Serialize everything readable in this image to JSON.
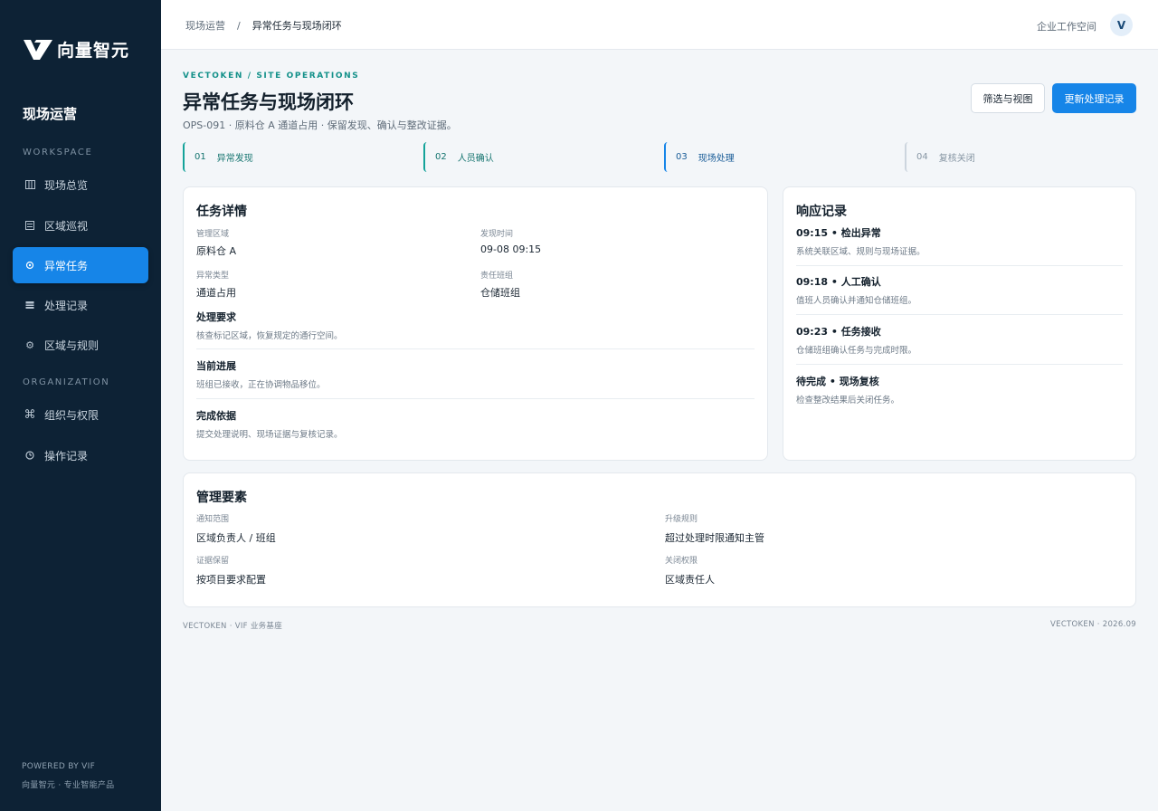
{
  "brand": {
    "name": "向量智元"
  },
  "sidebar": {
    "title": "现场运营",
    "workspace_label": "WORKSPACE",
    "organization_label": "ORGANIZATION",
    "workspace_items": [
      {
        "label": "现场总览",
        "icon": "columns-icon"
      },
      {
        "label": "区域巡视",
        "icon": "list-icon"
      },
      {
        "label": "异常任务",
        "icon": "target-icon",
        "active": true
      },
      {
        "label": "处理记录",
        "icon": "grid-icon"
      },
      {
        "label": "区域与规则",
        "icon": "gear-icon"
      }
    ],
    "organization_items": [
      {
        "label": "组织与权限",
        "icon": "command-icon"
      },
      {
        "label": "操作记录",
        "icon": "clock-icon"
      }
    ],
    "footer_line1": "POWERED BY VIF",
    "footer_line2": "向量智元 · 专业智能产品"
  },
  "topbar": {
    "breadcrumb_parent": "现场运营",
    "breadcrumb_sep": "/",
    "breadcrumb_current": "异常任务与现场闭环",
    "workspace": "企业工作空间",
    "avatar": "V"
  },
  "header": {
    "eyebrow": "VECTOKEN / SITE OPERATIONS",
    "title": "异常任务与现场闭环",
    "subtitle": "OPS-091 · 原料仓 A 通道占用 · 保留发现、确认与整改证据。",
    "filter_button": "筛选与视图",
    "primary_button": "更新处理记录"
  },
  "steps": [
    {
      "num": "01",
      "label": "异常发现",
      "state": "done"
    },
    {
      "num": "02",
      "label": "人员确认",
      "state": "done"
    },
    {
      "num": "03",
      "label": "现场处理",
      "state": "current"
    },
    {
      "num": "04",
      "label": "复核关闭",
      "state": "todo"
    }
  ],
  "task_detail": {
    "title": "任务详情",
    "fields": [
      {
        "label": "管理区域",
        "value": "原料仓 A"
      },
      {
        "label": "发现时间",
        "value": "09-08 09:15"
      },
      {
        "label": "异常类型",
        "value": "通道占用"
      },
      {
        "label": "责任班组",
        "value": "仓储班组"
      }
    ],
    "blocks": [
      {
        "title": "处理要求",
        "desc": "核查标记区域，恢复规定的通行空间。"
      },
      {
        "title": "当前进展",
        "desc": "班组已接收，正在协调物品移位。"
      },
      {
        "title": "完成依据",
        "desc": "提交处理说明、现场证据与复核记录。"
      }
    ]
  },
  "response_log": {
    "title": "响应记录",
    "entries": [
      {
        "title": "09:15 • 检出异常",
        "desc": "系统关联区域、规则与现场证据。"
      },
      {
        "title": "09:18 • 人工确认",
        "desc": "值班人员确认并通知仓储班组。"
      },
      {
        "title": "09:23 • 任务接收",
        "desc": "仓储班组确认任务与完成时限。"
      },
      {
        "title": "待完成 • 现场复核",
        "desc": "检查整改结果后关闭任务。"
      }
    ]
  },
  "management": {
    "title": "管理要素",
    "fields": [
      {
        "label": "通知范围",
        "value": "区域负责人 / 班组"
      },
      {
        "label": "升级规则",
        "value": "超过处理时限通知主管"
      },
      {
        "label": "证据保留",
        "value": "按项目要求配置"
      },
      {
        "label": "关闭权限",
        "value": "区域责任人"
      }
    ]
  },
  "footer": {
    "left": "VECTOKEN · VIF 业务基座",
    "right": "VECTOKEN · 2026.09"
  },
  "colors": {
    "sidebar_bg": "#0d2235",
    "accent": "#1685e8",
    "teal": "#14a39a",
    "page_bg": "#f3f6f9"
  }
}
